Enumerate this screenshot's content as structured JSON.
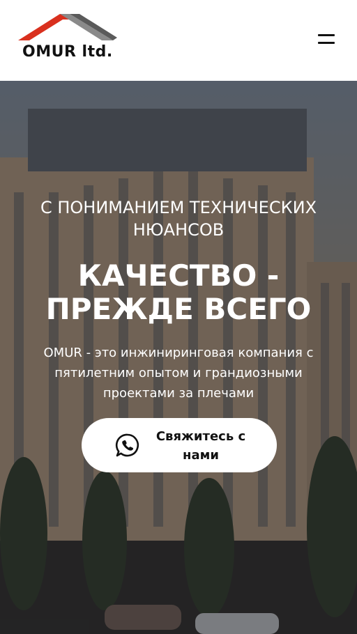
{
  "header": {
    "logo_text": "OMUR ltd.",
    "menu_icon": "hamburger-icon"
  },
  "hero": {
    "subtitle": "С ПОНИМАНИЕМ ТЕХНИЧЕСКИХ НЮАНСОВ",
    "title": "КАЧЕСТВО - ПРЕЖДЕ ВСЕГО",
    "description": "OMUR - это инжиниринговая компания с пятилетним опытом и грандиозными проектами за плечами",
    "cta": {
      "label": "Свяжитесь с нами",
      "icon": "whatsapp-icon"
    }
  },
  "colors": {
    "logo_roof_red": "#d9301e",
    "logo_roof_gray": "#8a8a8a",
    "text_dark": "#111111",
    "hero_text": "#ffffff",
    "cta_bg": "#ffffff"
  }
}
